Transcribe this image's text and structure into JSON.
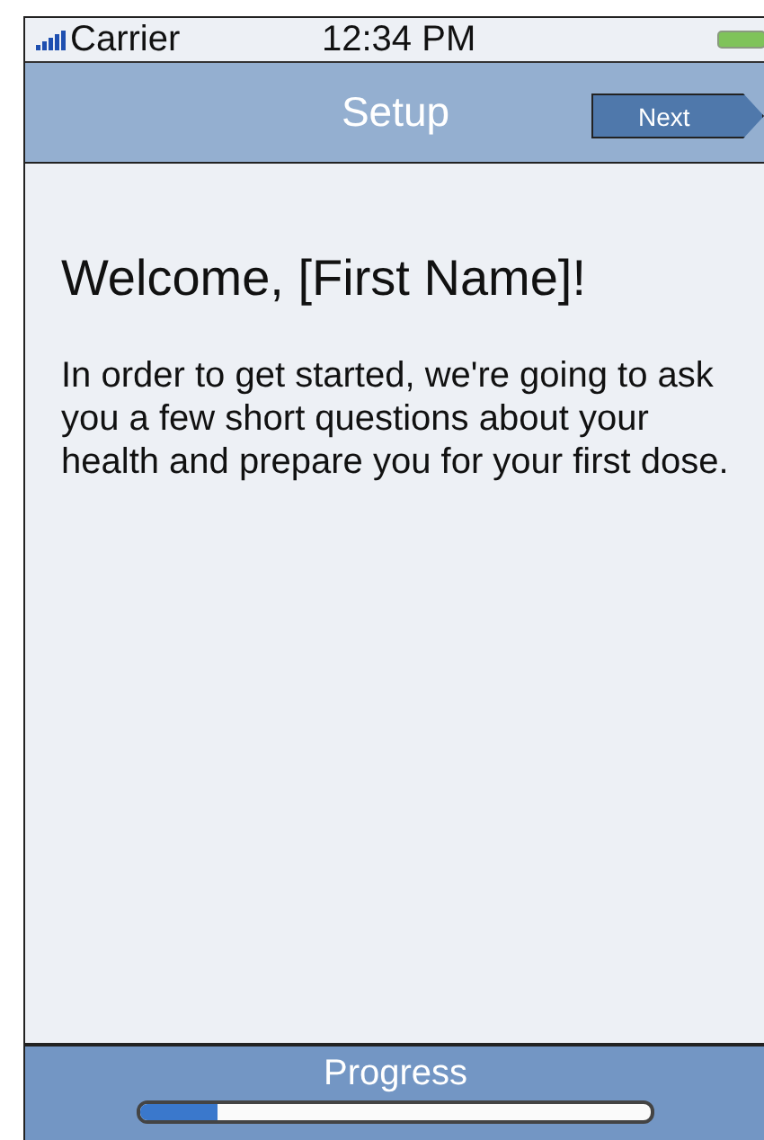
{
  "status_bar": {
    "carrier": "Carrier",
    "time": "12:34 PM"
  },
  "nav_bar": {
    "title": "Setup",
    "next_button": "Next"
  },
  "content": {
    "heading": "Welcome, [First Name]!",
    "body": "In order to get started, we're going to ask you a few short questions about your health and prepare you for your first dose."
  },
  "footer": {
    "label": "Progress",
    "level": 0.15
  }
}
